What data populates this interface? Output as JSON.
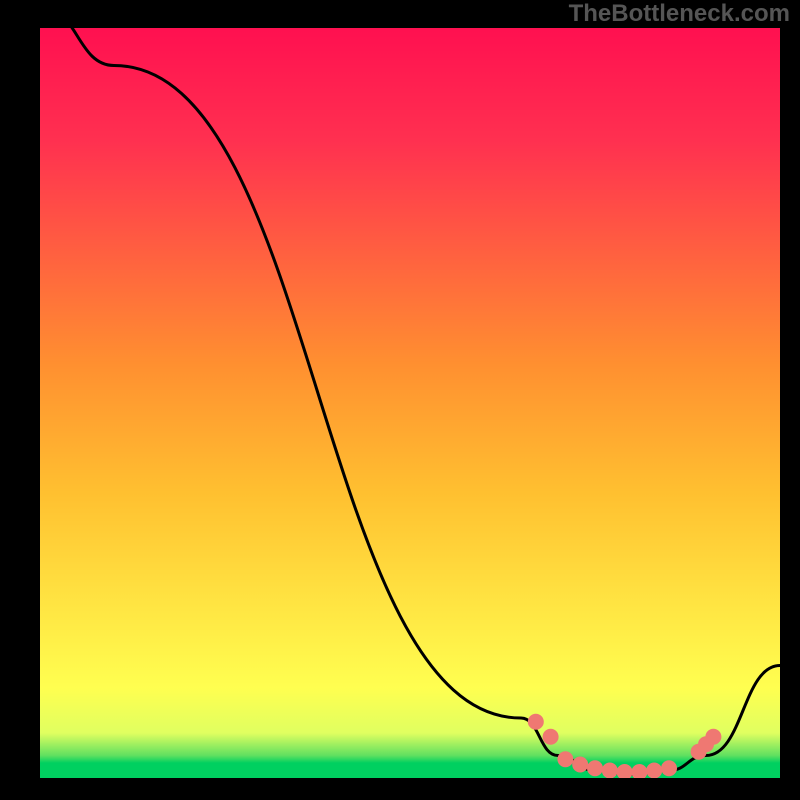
{
  "watermark": "TheBottleneck.com",
  "chart_data": {
    "type": "line",
    "title": "",
    "xlabel": "",
    "ylabel": "",
    "xlim": [
      0,
      100
    ],
    "ylim": [
      0,
      100
    ],
    "curve_points": [
      {
        "x": 0,
        "y": 103
      },
      {
        "x": 10,
        "y": 95
      },
      {
        "x": 65,
        "y": 8
      },
      {
        "x": 70,
        "y": 3
      },
      {
        "x": 75,
        "y": 1
      },
      {
        "x": 80,
        "y": 0.5
      },
      {
        "x": 85,
        "y": 1
      },
      {
        "x": 90,
        "y": 3
      },
      {
        "x": 100,
        "y": 15
      }
    ],
    "scatter_points": [
      {
        "x": 67,
        "y": 7.5
      },
      {
        "x": 69,
        "y": 5.5
      },
      {
        "x": 71,
        "y": 2.5
      },
      {
        "x": 73,
        "y": 1.8
      },
      {
        "x": 75,
        "y": 1.3
      },
      {
        "x": 77,
        "y": 1.0
      },
      {
        "x": 79,
        "y": 0.8
      },
      {
        "x": 81,
        "y": 0.8
      },
      {
        "x": 83,
        "y": 1.0
      },
      {
        "x": 85,
        "y": 1.3
      },
      {
        "x": 89,
        "y": 3.5
      },
      {
        "x": 90,
        "y": 4.5
      },
      {
        "x": 91,
        "y": 5.5
      }
    ],
    "gradient_stops": [
      {
        "pos": 0,
        "color": "#00d060"
      },
      {
        "pos": 6,
        "color": "#e0ff60"
      },
      {
        "pos": 12,
        "color": "#ffff50"
      },
      {
        "pos": 50,
        "color": "#ffb030"
      },
      {
        "pos": 100,
        "color": "#ff1050"
      }
    ]
  }
}
